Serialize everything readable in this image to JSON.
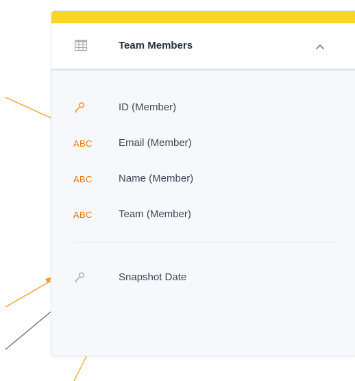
{
  "colors": {
    "accent": "#f7d629",
    "key_orange": "#f5a03c",
    "abc_orange": "#e8740c",
    "key_gray": "#a8b0bb",
    "connector_orange": "#f0a030",
    "connector_gray": "#6b6b6b"
  },
  "card": {
    "title": "Team Members",
    "header_icon": "table-icon",
    "collapse_icon": "chevron-up-icon"
  },
  "fields": [
    {
      "label": "ID (Member)",
      "type_icon": "key-icon"
    },
    {
      "label": "Email (Member)",
      "type_icon": "text-type-icon",
      "type_text": "ABC"
    },
    {
      "label": "Name (Member)",
      "type_icon": "text-type-icon",
      "type_text": "ABC"
    },
    {
      "label": "Team (Member)",
      "type_icon": "text-type-icon",
      "type_text": "ABC"
    }
  ],
  "secondary_fields": [
    {
      "label": "Snapshot Date",
      "type_icon": "key-icon"
    }
  ]
}
